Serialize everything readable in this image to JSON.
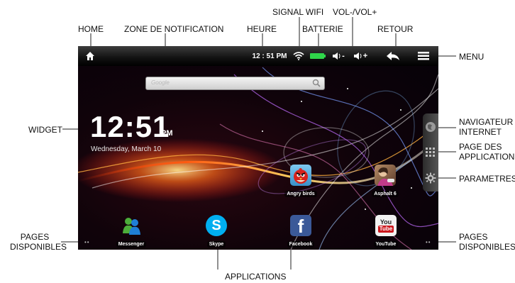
{
  "statusbar": {
    "time": "12 : 51 PM",
    "icons": [
      "home-icon",
      "wifi-icon",
      "battery-icon",
      "volume-down-icon",
      "volume-up-icon",
      "back-icon",
      "menu-icon"
    ],
    "vol_down_suffix": "-",
    "vol_up_suffix": "+"
  },
  "search": {
    "placeholder": "Google"
  },
  "widget": {
    "time": "12:51",
    "ampm": "PM",
    "date": "Wednesday, March 10"
  },
  "apps": {
    "angry_birds": "Angry birds",
    "asphalt": "Asphalt 6",
    "messenger": "Messenger",
    "skype": "Skype",
    "facebook": "Facebook",
    "youtube": "YouTube"
  },
  "icon_text": {
    "youtube_you": "You",
    "youtube_tube": "Tube",
    "facebook_f": "f",
    "skype_s": "S"
  },
  "pages_dots": "••",
  "callouts": {
    "home": "HOME",
    "notification_zone": "ZONE DE NOTIFICATION",
    "signal_wifi": "SIGNAL WIFI",
    "heure": "HEURE",
    "batterie": "BATTERIE",
    "vol": "VOL-/VOL+",
    "retour": "RETOUR",
    "menu": "MENU",
    "widget": "WIDGET",
    "navigateur_line1": "NAVIGATEUR",
    "navigateur_line2": "INTERNET",
    "page_apps_line1": "PAGE DES",
    "page_apps_line2": "APPLICATIONS",
    "parametres": "PARAMETRES",
    "pages_left_line1": "PAGES",
    "pages_left_line2": "DISPONIBLES",
    "pages_right_line1": "PAGES",
    "pages_right_line2": "DISPONIBLES",
    "applications": "APPLICATIONS"
  },
  "colors": {
    "statusbar_bg": "#000000",
    "battery_green": "#2fd64a",
    "facebook_blue": "#3b5998",
    "skype_blue": "#00aff0",
    "youtube_red": "#cc181e"
  }
}
